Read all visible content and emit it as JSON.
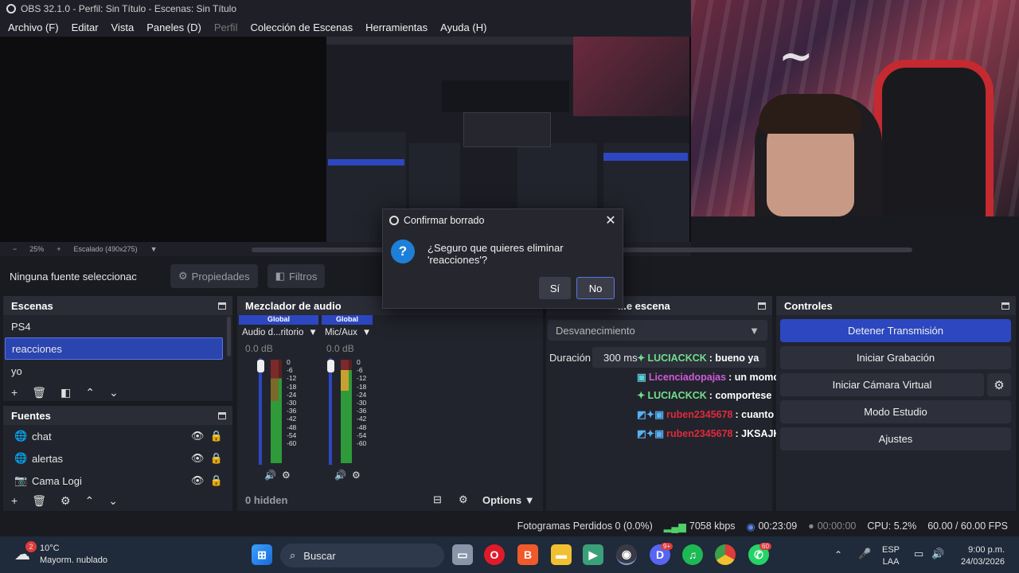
{
  "window": {
    "title": "OBS 32.1.0 - Perfil: Sin Título - Escenas: Sin Título"
  },
  "menu": [
    "Archivo (F)",
    "Editar",
    "Vista",
    "Paneles (D)",
    "Perfil",
    "Colección de Escenas",
    "Herramientas",
    "Ayuda (H)"
  ],
  "preview": {
    "zoom": "25%",
    "scale": "Escalado (490x275)"
  },
  "source_toolbar": {
    "no_source": "Ninguna fuente seleccionac",
    "properties": "Propiedades",
    "filters": "Filtros"
  },
  "scenes": {
    "title": "Escenas",
    "items": [
      "PS4",
      "reacciones",
      "yo"
    ],
    "selected": "reacciones"
  },
  "sources": {
    "title": "Fuentes",
    "items": [
      "chat",
      "alertas",
      "Cama Logi"
    ]
  },
  "mixer": {
    "title": "Mezclador de audio",
    "channels": [
      {
        "group": "Global",
        "name": "Audio d...ritorio",
        "db": "0.0 dB"
      },
      {
        "group": "Global",
        "name": "Mic/Aux",
        "db": "0.0 dB"
      }
    ],
    "scale": [
      "0",
      "-6",
      "-12",
      "-18",
      "-24",
      "-30",
      "-36",
      "-42",
      "-48",
      "-54",
      "-60"
    ],
    "hidden": "0 hidden",
    "options": "Options"
  },
  "transitions": {
    "title": "...e escena",
    "type": "Desvanecimiento",
    "duration_label": "Duración",
    "duration_value": "300 ms"
  },
  "controls": {
    "title": "Controles",
    "buttons": [
      "Detener Transmisión",
      "Iniciar Grabación",
      "Iniciar Cámara Virtual",
      "Modo Estudio",
      "Ajustes"
    ]
  },
  "chat": [
    {
      "user": "LUCIACKCK",
      "msg": ": bueno ya",
      "color": "#6fe08a"
    },
    {
      "user": "Licenciadopajas",
      "msg": ": un momo",
      "color": "#d05ad8"
    },
    {
      "user": "LUCIACKCK",
      "msg": ": comportese",
      "color": "#6fe08a"
    },
    {
      "user": "ruben2345678",
      "msg": ": cuanto lleva con obs",
      "color": "#e02a3a"
    },
    {
      "user": "ruben2345678",
      "msg": ": JKSAJKSAJKD",
      "color": "#e02a3a"
    }
  ],
  "status": {
    "dropped": "Fotogramas Perdidos 0 (0.0%)",
    "bitrate": "7058 kbps",
    "stream_time": "00:23:09",
    "rec_time": "00:00:00",
    "cpu": "CPU: 5.2%",
    "fps": "60.00 / 60.00 FPS"
  },
  "dialog": {
    "title": "Confirmar borrado",
    "message": "¿Seguro que quieres eliminar 'reacciones'?",
    "yes": "Sí",
    "no": "No"
  },
  "taskbar": {
    "weather_temp": "10°C",
    "weather_desc": "Mayorm. nublado",
    "weather_badge": "2",
    "search": "Buscar",
    "lang": "ESP",
    "lang2": "LAA",
    "time": "9:00 p.m.",
    "date": "24/03/2026",
    "discord_badge": "9+",
    "whatsapp_badge": "60"
  },
  "colors": {
    "accent": "#2c47c0",
    "panel": "#22242d",
    "header": "#2a2c36"
  }
}
